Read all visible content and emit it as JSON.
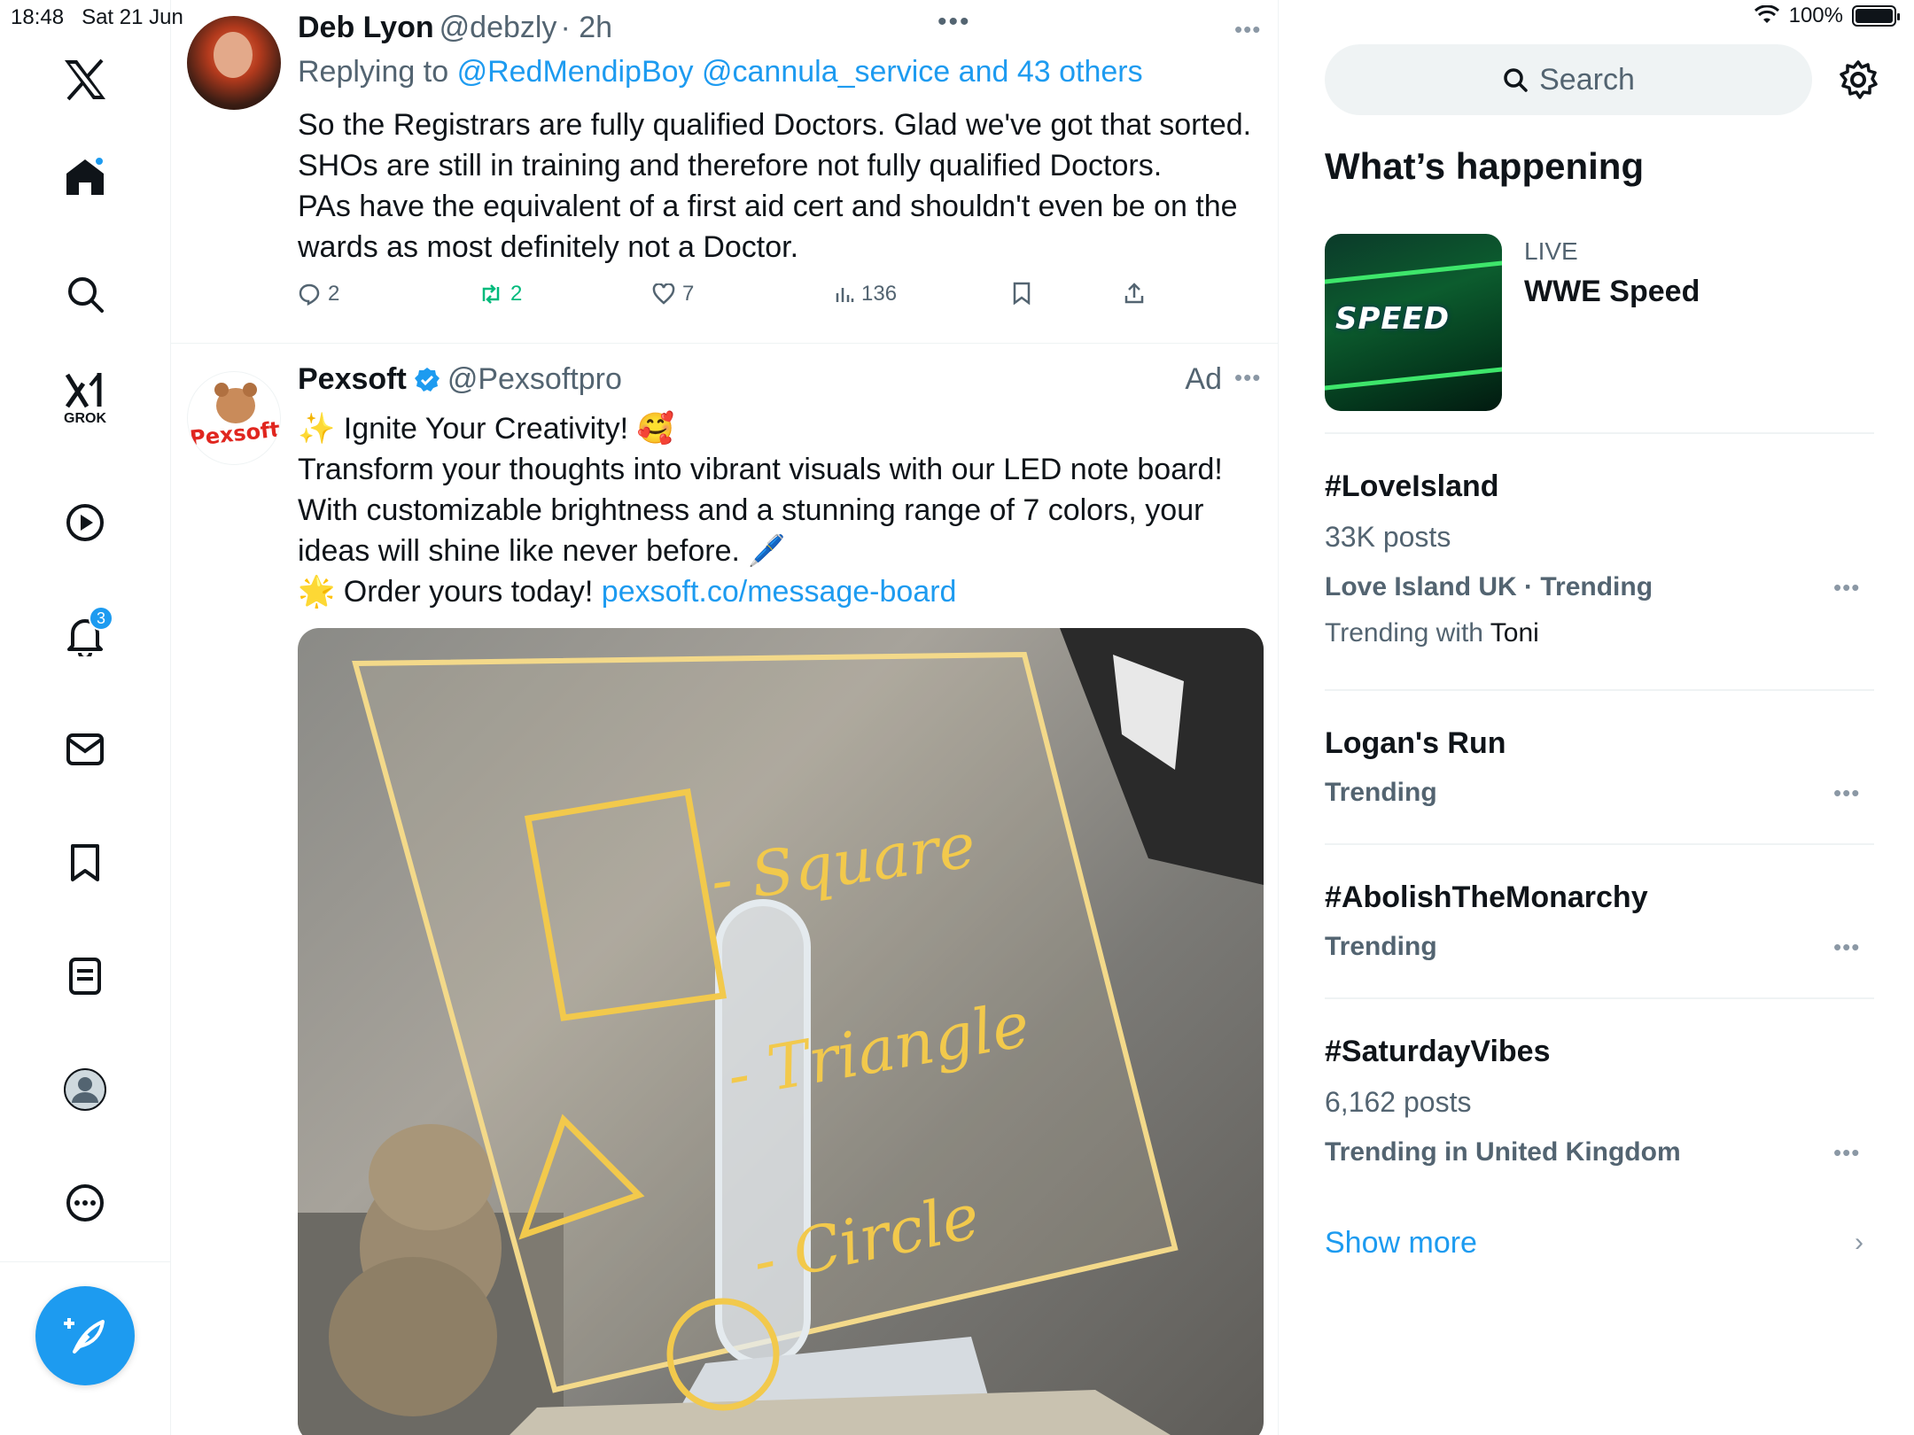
{
  "status": {
    "time": "18:48",
    "date": "Sat 21 Jun",
    "battery": "100%"
  },
  "nav": {
    "items": [
      "home",
      "explore",
      "grok",
      "video",
      "notifications",
      "messages",
      "bookmarks",
      "lists",
      "profile",
      "more"
    ],
    "grok_label": "GROK",
    "notifications_badge": "3"
  },
  "tweet1": {
    "name": "Deb Lyon",
    "handle": "@debzly",
    "time": "· 2h",
    "replying_prefix": "Replying to",
    "replying_to": "@RedMendipBoy @cannula_service and 43 others",
    "body": [
      "So the Registrars are fully qualified Doctors. Glad we've got that sorted.",
      "SHOs are still in training and therefore not fully qualified Doctors.",
      "PAs have the equivalent of a first aid cert and shouldn't even be on the",
      "wards as most definitely not a Doctor."
    ],
    "replies": "2",
    "reposts": "2",
    "likes": "7",
    "views": "136"
  },
  "tweet2": {
    "name": "Pexsoft",
    "handle": "@Pexsoftpro",
    "ad_label": "Ad",
    "avatar_text": "Pexsoft",
    "body": [
      "✨ Ignite Your Creativity! 🥰",
      "Transform your thoughts into vibrant visuals with our LED note board!",
      "With customizable brightness and a stunning range of 7 colors, your",
      "ideas will shine like never before. 🖊️"
    ],
    "order_text": "🌟 Order yours today!",
    "link": "pexsoft.co/message-board",
    "media_words": [
      "- Square",
      "- Triangle",
      "- Circle"
    ]
  },
  "sidebar": {
    "search_placeholder": "Search",
    "heading": "What’s happening",
    "live_label": "LIVE",
    "live_title": "WWE Speed",
    "live_image_text": "SPEED",
    "trends": [
      {
        "title": "#LoveIsland",
        "posts": "33K posts",
        "meta": "Love Island UK · Trending",
        "with_prefix": "Trending with",
        "with_name": "Toni"
      },
      {
        "title": "Logan's Run",
        "meta": "Trending"
      },
      {
        "title": "#AbolishTheMonarchy",
        "meta": "Trending"
      },
      {
        "title": "#SaturdayVibes",
        "posts": "6,162 posts",
        "meta": "Trending in United Kingdom"
      }
    ],
    "show_more": "Show more"
  },
  "colors": {
    "accent": "#1d9bf0",
    "repost_green": "#00ba7c",
    "secondary_text": "#536471"
  }
}
